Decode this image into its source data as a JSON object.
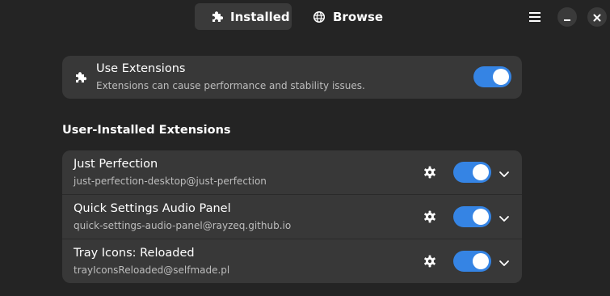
{
  "header": {
    "tabs": [
      {
        "label": "Installed",
        "icon": "puzzle-icon",
        "active": true
      },
      {
        "label": "Browse",
        "icon": "globe-icon",
        "active": false
      }
    ],
    "menu_icon": "hamburger-menu-icon",
    "minimize_icon": "minimize-icon",
    "close_icon": "close-icon"
  },
  "use_extensions": {
    "title": "Use Extensions",
    "subtitle": "Extensions can cause performance and stability issues.",
    "icon": "puzzle-icon",
    "enabled": true
  },
  "section_title": "User-Installed Extensions",
  "extensions": [
    {
      "name": "Just Perfection",
      "uuid": "just-perfection-desktop@just-perfection",
      "enabled": true
    },
    {
      "name": "Quick Settings Audio Panel",
      "uuid": "quick-settings-audio-panel@rayzeq.github.io",
      "enabled": true
    },
    {
      "name": "Tray Icons: Reloaded",
      "uuid": "trayIconsReloaded@selfmade.pl",
      "enabled": true
    }
  ],
  "colors": {
    "background": "#242424",
    "card": "#383838",
    "accent": "#3584e4"
  }
}
